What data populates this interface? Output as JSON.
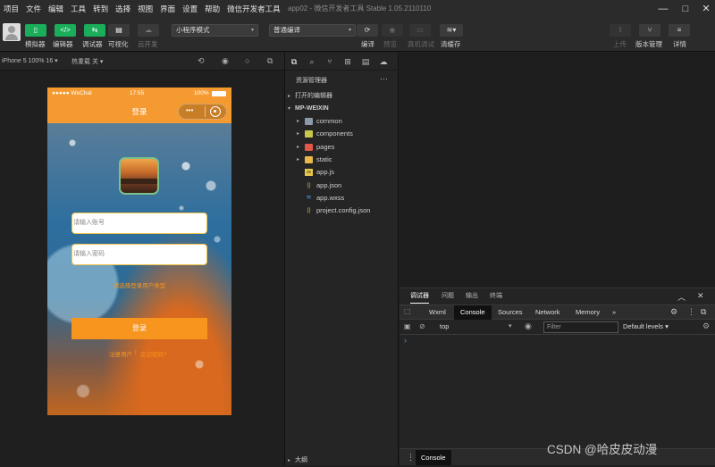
{
  "menu": [
    "项目",
    "文件",
    "编辑",
    "工具",
    "转到",
    "选择",
    "视图",
    "界面",
    "设置",
    "帮助",
    "微信开发者工具"
  ],
  "window_title": "app02 - 微信开发者工具 Stable 1.05.2110110",
  "toolbar": {
    "left_buttons": [
      {
        "label": "模拟器",
        "icon": "phone-icon",
        "color": "#1aad5a"
      },
      {
        "label": "编辑器",
        "icon": "code-icon",
        "color": "#1aad5a"
      },
      {
        "label": "调试器",
        "icon": "debug-icon",
        "color": "#1aad5a"
      },
      {
        "label": "可视化",
        "icon": "layout-icon",
        "color": "#3a3a3a"
      },
      {
        "label": "云开发",
        "icon": "cloud-icon",
        "color": "#3a3a3a"
      }
    ],
    "mode_select": "小程序模式",
    "compile_select": "普通编译",
    "mid_labels": [
      "编译",
      "预览",
      "真机调试",
      "清缓存"
    ],
    "right_labels": [
      "上传",
      "版本管理",
      "详情"
    ]
  },
  "simbar": {
    "device": "iPhone 5 100% 16",
    "hotreload": "热重载 关"
  },
  "phone": {
    "carrier": "●●●●● WeChat",
    "time": "17:55",
    "battery": "100%",
    "title": "登录",
    "menu_dots": "•••",
    "account_placeholder": "请输入账号",
    "password_placeholder": "请输入密码",
    "agreement": "请选择登录用户类型",
    "login": "登录",
    "register": "注册用户",
    "forgot": "忘记密码?"
  },
  "explorer": {
    "title": "资源管理器",
    "more": "···",
    "open_editors": "打开的编辑器",
    "project": "MP-WEIXIN",
    "items": [
      {
        "label": "common",
        "icon": "folder-icon",
        "color": "#8b9aa8",
        "type": "folder"
      },
      {
        "label": "components",
        "icon": "folder-icon",
        "color": "#c7c74a",
        "type": "folder"
      },
      {
        "label": "pages",
        "icon": "folder-icon",
        "color": "#e0584a",
        "type": "folder"
      },
      {
        "label": "static",
        "icon": "folder-icon",
        "color": "#e8b84a",
        "type": "folder"
      },
      {
        "label": "app.js",
        "icon": "js-icon",
        "color": "#e8c84a",
        "type": "file"
      },
      {
        "label": "app.json",
        "icon": "json-icon",
        "color": "#e8b84a",
        "type": "file"
      },
      {
        "label": "app.wxss",
        "icon": "css-icon",
        "color": "#4a9be8",
        "type": "file"
      },
      {
        "label": "project.config.json",
        "icon": "json-icon",
        "color": "#e8b84a",
        "type": "file"
      }
    ],
    "outline": "大纲"
  },
  "devtools": {
    "top_tabs": [
      "调试器",
      "问题",
      "输出",
      "终端"
    ],
    "tabs": [
      "Wxml",
      "Console",
      "Sources",
      "Network",
      "Memory"
    ],
    "more_tabs": "»",
    "context": "top",
    "filter_placeholder": "Filter",
    "levels": "Default levels",
    "prompt": "›",
    "drawer_tab": "Console"
  },
  "watermark": "CSDN @哈皮皮动漫"
}
